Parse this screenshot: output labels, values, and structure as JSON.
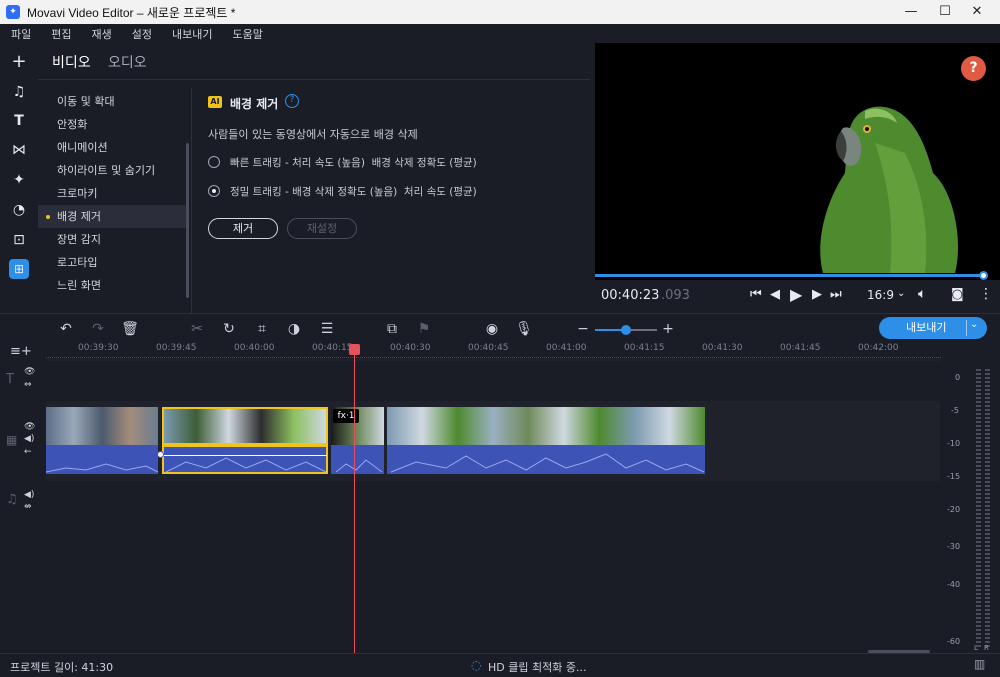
{
  "window": {
    "title": "Movavi Video Editor – 새로운 프로젝트 *"
  },
  "menu": [
    "파일",
    "편집",
    "재생",
    "설정",
    "내보내기",
    "도움말"
  ],
  "panel": {
    "tabs": [
      "비디오",
      "오디오"
    ],
    "categories": [
      "이동 및 확대",
      "안정화",
      "애니메이션",
      "하이라이트 및 숨기기",
      "크로마키",
      "배경 제거",
      "장면 감지",
      "로고타입",
      "느린 화면"
    ],
    "selected": "배경 제거",
    "ai_badge": "AI",
    "title": "배경 제거",
    "help": "?",
    "description": "사람들이 있는 동영상에서 자동으로 배경 삭제",
    "option_fast": "빠른 트래킹 - 처리 속도 (높음)  배경 삭제 정확도 (평균)",
    "option_precise": "정밀 트래킹 - 배경 삭제 정확도 (높음)  처리 속도 (평균)",
    "remove_button": "제거",
    "reset_button": "재설정"
  },
  "preview": {
    "time_main": "00:40:23",
    "time_ms": ".093",
    "aspect": "16:9",
    "help": "?"
  },
  "timeline": {
    "export_button": "내보내기",
    "ruler": [
      "00:39:30",
      "00:39:45",
      "00:40:00",
      "00:40:15",
      "00:40:30",
      "00:40:45",
      "00:41:00",
      "00:41:15",
      "00:41:30",
      "00:41:45",
      "00:42:00"
    ],
    "fx_badge": "fx·1",
    "meter_labels": [
      "0",
      "-5",
      "-10",
      "-15",
      "-20",
      "-30",
      "-40",
      "-60"
    ],
    "meter_lr": [
      "L",
      "R"
    ]
  },
  "status": {
    "length": "프로젝트 길이: 41:30",
    "optimizing": "HD 클립 최적화 중..."
  },
  "colors": {
    "accent": "#2e8fe8",
    "selection": "#f0c419",
    "playhead": "#e8505b",
    "audio": "#3d53b5"
  }
}
